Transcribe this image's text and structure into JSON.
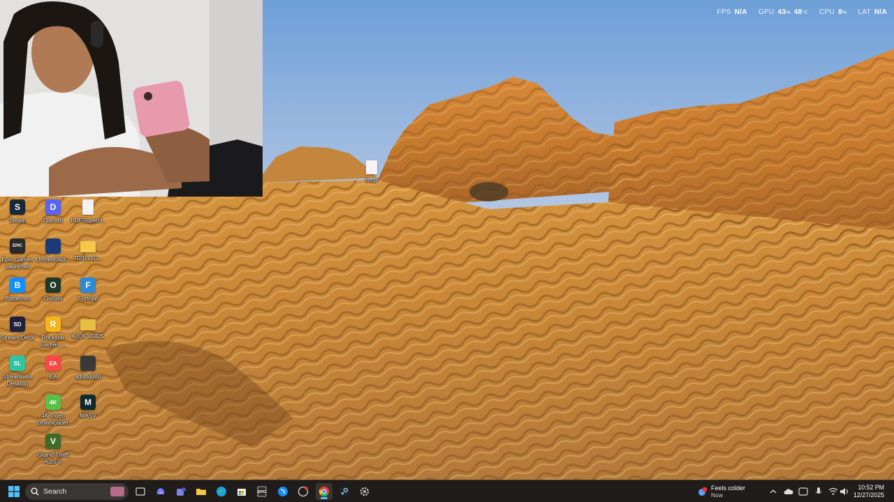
{
  "overlay": {
    "fps_label": "FPS",
    "fps_value": "N/A",
    "gpu_label": "GPU",
    "gpu_value": "43",
    "gpu_temp": "48",
    "cpu_label": "CPU",
    "cpu_value": "8",
    "lat_label": "LAT",
    "lat_value": "N/A"
  },
  "desktop": {
    "floating_file": {
      "label": "fx.rpt"
    },
    "icons": [
      {
        "label": "Steam",
        "icon": "steam-icon",
        "color": "#1b2838",
        "glyph": "S"
      },
      {
        "label": "Discord",
        "icon": "discord-icon",
        "color": "#5865f2",
        "glyph": "D"
      },
      {
        "label": "PDFSuperH...",
        "icon": "document-icon",
        "color": "#f2f2f2",
        "glyph": ""
      },
      {
        "label": "Epic Games Launcher",
        "icon": "epic-games-icon",
        "color": "#2a2a2a",
        "glyph": "EPIC"
      },
      {
        "label": "Untitled348...",
        "icon": "project-file-icon",
        "color": "#1d3b7a",
        "glyph": ""
      },
      {
        "label": "7D31v1C...",
        "icon": "folder-icon",
        "color": "#f5c84a",
        "glyph": ""
      },
      {
        "label": "Battle.net",
        "icon": "battlenet-icon",
        "color": "#148eff",
        "glyph": "B"
      },
      {
        "label": "Outlast",
        "icon": "outlast-icon",
        "color": "#1f3a2a",
        "glyph": "O"
      },
      {
        "label": "Fortnite",
        "icon": "fortnite-icon",
        "color": "#2d8ad8",
        "glyph": "F"
      },
      {
        "label": "Stream Deck",
        "icon": "stream-deck-icon",
        "color": "#20203a",
        "glyph": "SD"
      },
      {
        "label": "Rockstar Games ...",
        "icon": "rockstar-icon",
        "color": "#f6b31a",
        "glyph": "R"
      },
      {
        "label": "KICK VODS",
        "icon": "folder-icon",
        "color": "#e8c040",
        "glyph": ""
      },
      {
        "label": "Streamlabs Desktop",
        "icon": "streamlabs-icon",
        "color": "#31c3a2",
        "glyph": "SL"
      },
      {
        "label": "EA",
        "icon": "ea-icon",
        "color": "#ff4747",
        "glyph": "EA"
      },
      {
        "label": "addddddd",
        "icon": "controller-icon",
        "color": "#3a3a3a",
        "glyph": ""
      },
      {
        "label": "4K Video Downloader",
        "icon": "downloader-icon",
        "color": "#5cbf4a",
        "glyph": "4K"
      },
      {
        "label": "MASV",
        "icon": "masv-icon",
        "color": "#0f2b2b",
        "glyph": "M"
      },
      {
        "label": "Grand Theft Auto V",
        "icon": "gta-icon",
        "color": "#3f6a2a",
        "glyph": "V"
      }
    ]
  },
  "taskbar": {
    "search_placeholder": "Search",
    "weather_title": "Feels colder",
    "weather_sub": "Now",
    "time": "10:52 PM",
    "date": "12/27/2025"
  }
}
